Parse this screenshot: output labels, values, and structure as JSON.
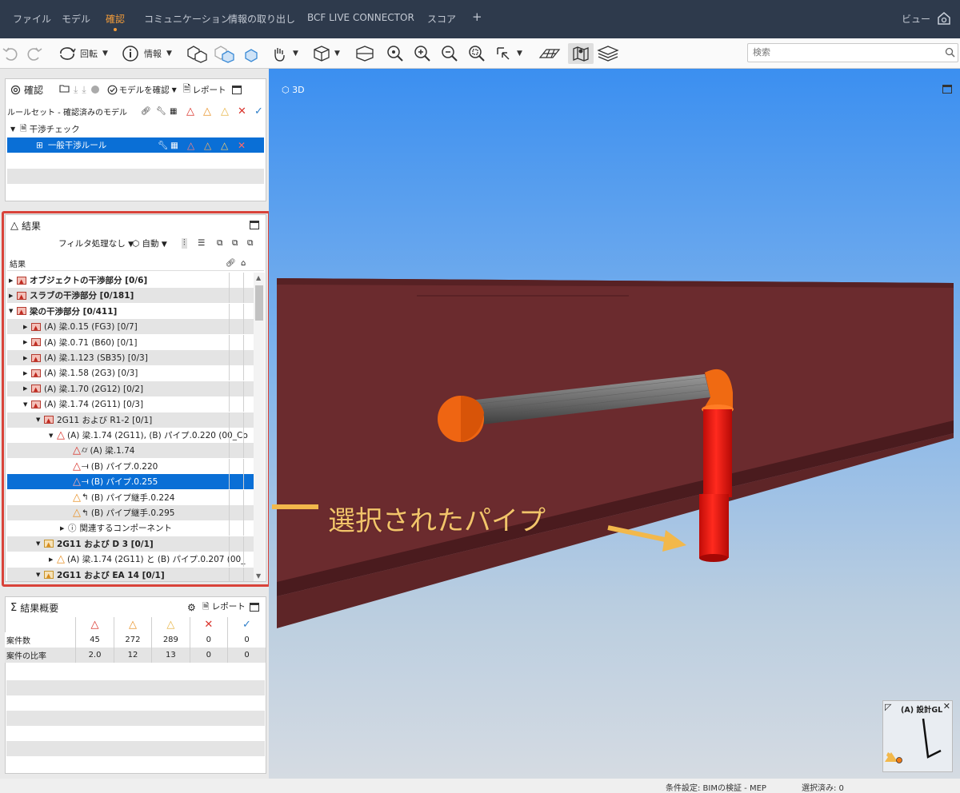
{
  "topbar": {
    "tabs": [
      "ファイル",
      "モデル",
      "確認",
      "コミュニケーション",
      "情報の取り出し",
      "BCF LIVE CONNECTOR",
      "スコア"
    ],
    "active_tab": "確認",
    "add_label": "+",
    "view_label": "ビュー"
  },
  "toolbar": {
    "rotate_label": "回転",
    "info_label": "情報",
    "search_placeholder": "検索"
  },
  "check_panel": {
    "title": "確認",
    "check_model_label": "モデルを確認",
    "report_label": "レポート",
    "column_header": "ルールセット - 確認済みのモデル",
    "ruleset": "干渉チェック",
    "rule": "一般干渉ルール"
  },
  "results_panel": {
    "title": "結果",
    "filter_label": "フィルタ処理なし",
    "auto_label": "自動",
    "column_header": "結果",
    "rows": [
      {
        "label": "オブジェクトの干渉部分 [0/6]",
        "bold": true
      },
      {
        "label": "スラブの干渉部分 [0/181]",
        "bold": true
      },
      {
        "label": "梁の干渉部分 [0/411]",
        "bold": true
      },
      {
        "label": "(A) 梁.0.15 (FG3) [0/7]"
      },
      {
        "label": "(A) 梁.0.71 (B60) [0/1]"
      },
      {
        "label": "(A) 梁.1.123 (SB35) [0/3]"
      },
      {
        "label": "(A) 梁.1.58 (2G3) [0/3]"
      },
      {
        "label": "(A) 梁.1.70 (2G12) [0/2]"
      },
      {
        "label": "(A) 梁.1.74 (2G11) [0/3]"
      },
      {
        "label": "2G11 および R1-2 [0/1]"
      },
      {
        "label": "(A) 梁.1.74 (2G11), (B) パイプ.0.220 (00_Co"
      },
      {
        "label": "(A) 梁.1.74"
      },
      {
        "label": "(B) パイプ.0.220"
      },
      {
        "label": "(B) パイプ.0.255"
      },
      {
        "label": "(B) パイプ継手.0.224"
      },
      {
        "label": "(B) パイプ継手.0.295"
      },
      {
        "label": "関連するコンポーネント"
      },
      {
        "label": "2G11 および D 3 [0/1]",
        "bold": true
      },
      {
        "label": "(A) 梁.1.74 (2G11) と (B) パイプ.0.207 (00_"
      },
      {
        "label": "2G11 および EA 14 [0/1]",
        "bold": true
      }
    ]
  },
  "summary_panel": {
    "title": "結果概要",
    "report_label": "レポート",
    "rows": [
      {
        "label": "案件数",
        "values": [
          "45",
          "272",
          "289",
          "0",
          "0"
        ]
      },
      {
        "label": "案件の比率",
        "values": [
          "2.0",
          "12",
          "13",
          "0",
          "0"
        ]
      }
    ]
  },
  "viewport": {
    "label": "3D",
    "annotation": "選択されたパイプ",
    "minimap_label": "(A) 設計GL"
  },
  "status": {
    "condition": "条件設定: BIMの検証 - MEP",
    "selected": "選択済み: 0"
  },
  "colors": {
    "accent": "#f39c3a",
    "topbar": "#2e3a4c",
    "selection": "#0a6fd6",
    "beam": "#6b2b2e",
    "pipe": "#e8150f",
    "arrow": "#f2b84b"
  }
}
